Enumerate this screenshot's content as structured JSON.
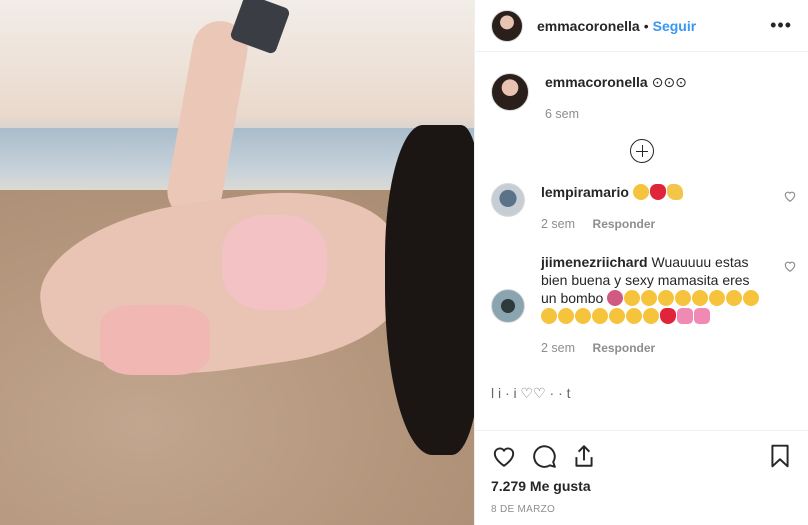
{
  "header": {
    "username": "emmacoronella",
    "separator": "•",
    "follow_label": "Seguir",
    "more_icon": "more-options-icon"
  },
  "caption": {
    "username": "emmacoronella",
    "text": "⊙⊙⊙",
    "time": "6 sem"
  },
  "comments": [
    {
      "username": "lempiramario",
      "text": "",
      "emojis": [
        "kiss",
        "red-heart",
        "clap"
      ],
      "time": "2 sem",
      "reply_label": "Responder"
    },
    {
      "username": "jiimenezriichard",
      "text": "Wuauuuu estas bien buena y sexy mamasita eres un bombo",
      "emojis": [
        "tongue",
        "kiss",
        "kiss",
        "kiss",
        "kiss",
        "kiss",
        "kiss",
        "kiss",
        "kiss",
        "kiss",
        "kiss",
        "kiss",
        "kiss",
        "kiss",
        "kiss",
        "kiss",
        "heart-eyes",
        "red-heart",
        "pink-heart",
        "pink-heart"
      ],
      "time": "2 sem",
      "reply_label": "Responder"
    }
  ],
  "partial_comment": "l        i  ·  i   ♡♡  ·  ·   t",
  "actions": {
    "like_icon": "heart-icon",
    "comment_icon": "comment-icon",
    "share_icon": "share-icon",
    "save_icon": "bookmark-icon",
    "likes": "7.279 Me gusta",
    "date": "8 DE MARZO"
  }
}
